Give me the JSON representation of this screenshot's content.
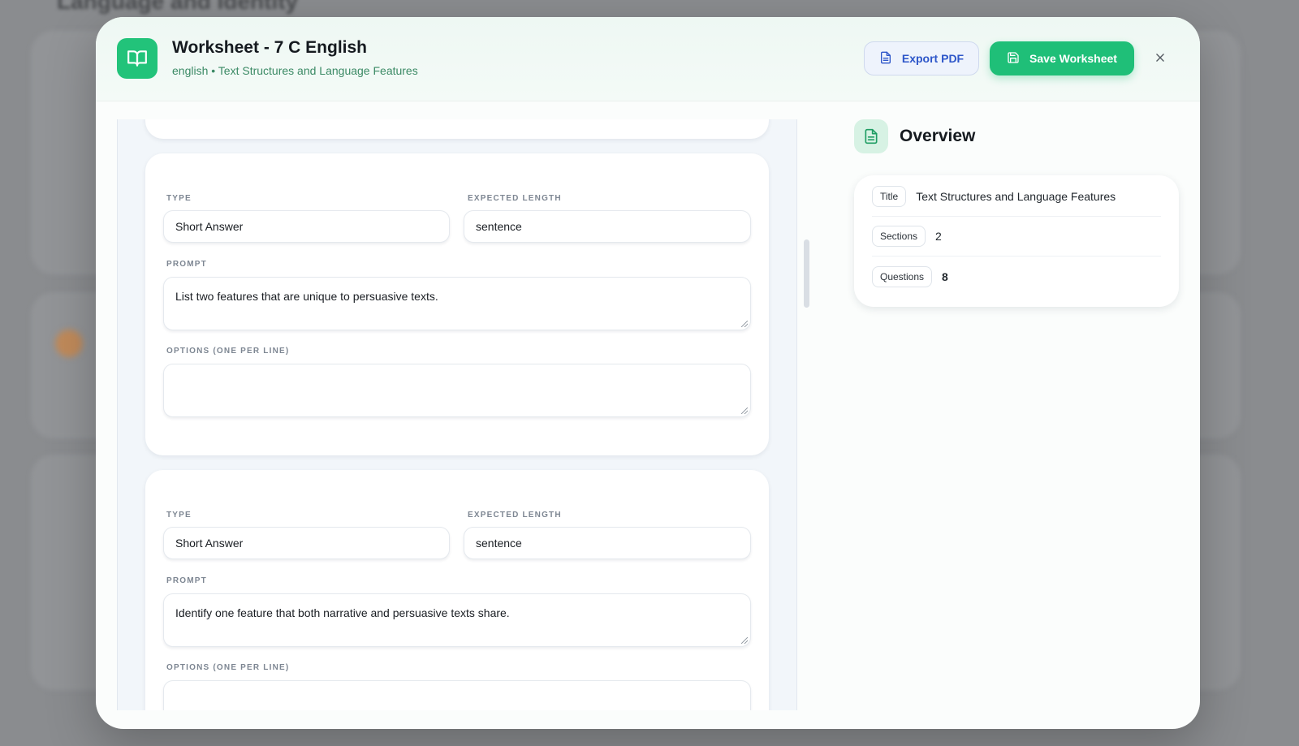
{
  "backdrop": {
    "heading": "Language and Identity"
  },
  "header": {
    "title": "Worksheet - 7 C English",
    "subtitle": "english • Text Structures and Language Features",
    "export_label": "Export PDF",
    "save_label": "Save Worksheet"
  },
  "questions": [
    {
      "type_label": "TYPE",
      "type_value": "Short Answer",
      "length_label": "EXPECTED LENGTH",
      "length_value": "sentence",
      "prompt_label": "PROMPT",
      "prompt_value": "List two features that are unique to persuasive texts.",
      "options_label": "OPTIONS (ONE PER LINE)",
      "options_value": ""
    },
    {
      "type_label": "TYPE",
      "type_value": "Short Answer",
      "length_label": "EXPECTED LENGTH",
      "length_value": "sentence",
      "prompt_label": "PROMPT",
      "prompt_value": "Identify one feature that both narrative and persuasive texts share.",
      "options_label": "OPTIONS (ONE PER LINE)",
      "options_value": ""
    }
  ],
  "overview": {
    "heading": "Overview",
    "rows": [
      {
        "key": "Title",
        "value": "Text Structures and Language Features"
      },
      {
        "key": "Sections",
        "value": "2"
      },
      {
        "key": "Questions",
        "value": "8"
      }
    ]
  },
  "colors": {
    "accent_green": "#1fbf78",
    "export_blue": "#2d56c9",
    "subtitle_green": "#3b8a65"
  }
}
